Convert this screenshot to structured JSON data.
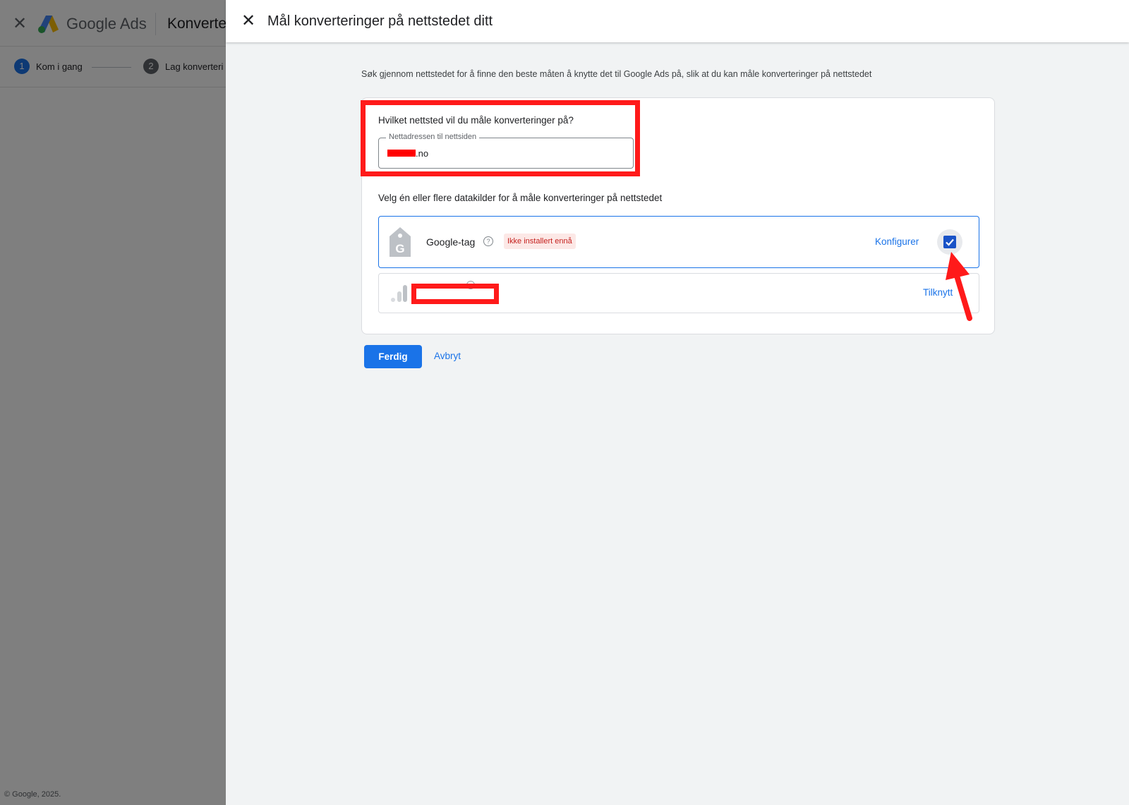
{
  "background": {
    "brand": "Google Ads",
    "section_title": "Konverte",
    "steps": [
      {
        "number": "1",
        "label": "Kom i gang",
        "color": "#1a73e8"
      },
      {
        "number": "2",
        "label": "Lag konverteri",
        "color": "#5f6368"
      }
    ],
    "footer": "© Google, 2025."
  },
  "panel": {
    "title": "Mål konverteringer på nettstedet ditt",
    "intro": "Søk gjennom nettstedet for å finne den beste måten å knytte det til Google Ads på, slik at du kan måle konverteringer på nettstedet",
    "website_question": "Hvilket nettsted vil du måle konverteringer på?",
    "url_field": {
      "label": "Nettadressen til nettsiden",
      "value": ".no"
    },
    "sources_label": "Velg én eller flere datakilder for å måle konverteringer på nettstedet",
    "sources": [
      {
        "name": "Google-tag",
        "status": "Ikke installert ennå",
        "action": "Konfigurer",
        "checked": true
      },
      {
        "name": "",
        "action": "Tilknytt"
      }
    ],
    "done_button": "Ferdig",
    "cancel_button": "Avbryt"
  },
  "colors": {
    "accent": "#1a73e8",
    "annotation": "#ff1a1a",
    "status_text": "#c5221f",
    "status_bg": "#fce8e6"
  }
}
